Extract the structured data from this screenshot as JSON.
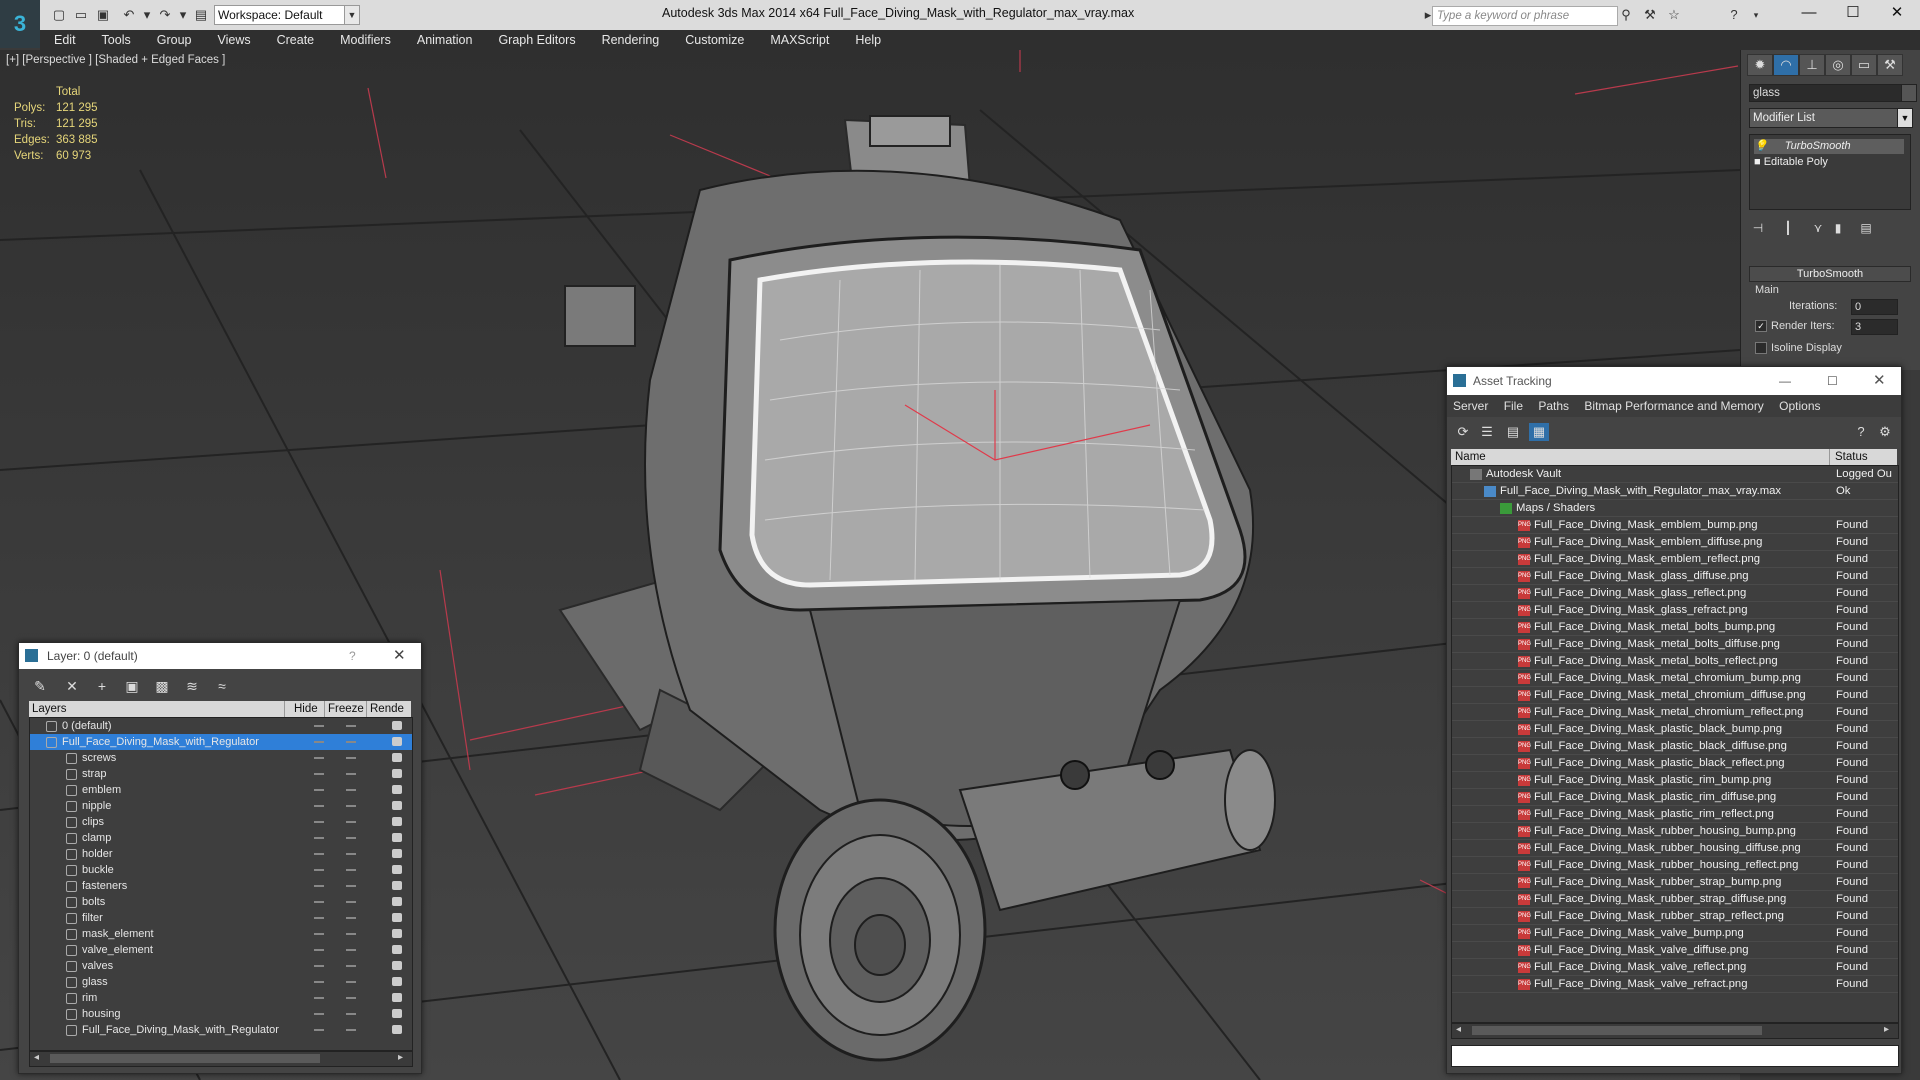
{
  "app": {
    "title": "Autodesk 3ds Max  2014 x64      Full_Face_Diving_Mask_with_Regulator_max_vray.max",
    "workspace": "Workspace: Default",
    "search_placeholder": "Type a keyword or phrase"
  },
  "menu": [
    "Edit",
    "Tools",
    "Group",
    "Views",
    "Create",
    "Modifiers",
    "Animation",
    "Graph Editors",
    "Rendering",
    "Customize",
    "MAXScript",
    "Help"
  ],
  "viewport": {
    "label": "[+] [Perspective ] [Shaded + Edged Faces ]",
    "stats_header": "Total",
    "stats": [
      {
        "label": "Polys:",
        "value": "121 295"
      },
      {
        "label": "Tris:",
        "value": "121 295"
      },
      {
        "label": "Edges:",
        "value": "363 885"
      },
      {
        "label": "Verts:",
        "value": "60 973"
      }
    ]
  },
  "command_panel": {
    "object_name": "glass",
    "modifier_list": "Modifier List",
    "stack": [
      "TurboSmooth",
      "Editable Poly"
    ],
    "rollout_title": "TurboSmooth",
    "group_main": "Main",
    "iterations_label": "Iterations:",
    "iterations_value": "0",
    "render_iters_label": "Render Iters:",
    "render_iters_value": "3",
    "isoline_label": "Isoline Display"
  },
  "layer_window": {
    "title": "Layer: 0 (default)",
    "columns": {
      "layers": "Layers",
      "hide": "Hide",
      "freeze": "Freeze",
      "render": "Rende"
    },
    "layers": [
      {
        "name": "0 (default)",
        "level": 0,
        "selected": false
      },
      {
        "name": "Full_Face_Diving_Mask_with_Regulator",
        "level": 0,
        "selected": true
      },
      {
        "name": "screws",
        "level": 1,
        "selected": false
      },
      {
        "name": "strap",
        "level": 1,
        "selected": false
      },
      {
        "name": "emblem",
        "level": 1,
        "selected": false
      },
      {
        "name": "nipple",
        "level": 1,
        "selected": false
      },
      {
        "name": "clips",
        "level": 1,
        "selected": false
      },
      {
        "name": "clamp",
        "level": 1,
        "selected": false
      },
      {
        "name": "holder",
        "level": 1,
        "selected": false
      },
      {
        "name": "buckle",
        "level": 1,
        "selected": false
      },
      {
        "name": "fasteners",
        "level": 1,
        "selected": false
      },
      {
        "name": "bolts",
        "level": 1,
        "selected": false
      },
      {
        "name": "filter",
        "level": 1,
        "selected": false
      },
      {
        "name": "mask_element",
        "level": 1,
        "selected": false
      },
      {
        "name": "valve_element",
        "level": 1,
        "selected": false
      },
      {
        "name": "valves",
        "level": 1,
        "selected": false
      },
      {
        "name": "glass",
        "level": 1,
        "selected": false
      },
      {
        "name": "rim",
        "level": 1,
        "selected": false
      },
      {
        "name": "housing",
        "level": 1,
        "selected": false
      },
      {
        "name": "Full_Face_Diving_Mask_with_Regulator",
        "level": 1,
        "selected": false
      }
    ]
  },
  "asset_window": {
    "title": "Asset Tracking",
    "menu": [
      "Server",
      "File",
      "Paths",
      "Bitmap Performance and Memory",
      "Options"
    ],
    "columns": {
      "name": "Name",
      "status": "Status"
    },
    "rows": [
      {
        "name": "Autodesk Vault",
        "status": "Logged Ou",
        "level": 0,
        "kind": "vault"
      },
      {
        "name": "Full_Face_Diving_Mask_with_Regulator_max_vray.max",
        "status": "Ok",
        "level": 1,
        "kind": "max"
      },
      {
        "name": "Maps / Shaders",
        "status": "",
        "level": 2,
        "kind": "folder"
      },
      {
        "name": "Full_Face_Diving_Mask_emblem_bump.png",
        "status": "Found",
        "level": 3,
        "kind": "png"
      },
      {
        "name": "Full_Face_Diving_Mask_emblem_diffuse.png",
        "status": "Found",
        "level": 3,
        "kind": "png"
      },
      {
        "name": "Full_Face_Diving_Mask_emblem_reflect.png",
        "status": "Found",
        "level": 3,
        "kind": "png"
      },
      {
        "name": "Full_Face_Diving_Mask_glass_diffuse.png",
        "status": "Found",
        "level": 3,
        "kind": "png"
      },
      {
        "name": "Full_Face_Diving_Mask_glass_reflect.png",
        "status": "Found",
        "level": 3,
        "kind": "png"
      },
      {
        "name": "Full_Face_Diving_Mask_glass_refract.png",
        "status": "Found",
        "level": 3,
        "kind": "png"
      },
      {
        "name": "Full_Face_Diving_Mask_metal_bolts_bump.png",
        "status": "Found",
        "level": 3,
        "kind": "png"
      },
      {
        "name": "Full_Face_Diving_Mask_metal_bolts_diffuse.png",
        "status": "Found",
        "level": 3,
        "kind": "png"
      },
      {
        "name": "Full_Face_Diving_Mask_metal_bolts_reflect.png",
        "status": "Found",
        "level": 3,
        "kind": "png"
      },
      {
        "name": "Full_Face_Diving_Mask_metal_chromium_bump.png",
        "status": "Found",
        "level": 3,
        "kind": "png"
      },
      {
        "name": "Full_Face_Diving_Mask_metal_chromium_diffuse.png",
        "status": "Found",
        "level": 3,
        "kind": "png"
      },
      {
        "name": "Full_Face_Diving_Mask_metal_chromium_reflect.png",
        "status": "Found",
        "level": 3,
        "kind": "png"
      },
      {
        "name": "Full_Face_Diving_Mask_plastic_black_bump.png",
        "status": "Found",
        "level": 3,
        "kind": "png"
      },
      {
        "name": "Full_Face_Diving_Mask_plastic_black_diffuse.png",
        "status": "Found",
        "level": 3,
        "kind": "png"
      },
      {
        "name": "Full_Face_Diving_Mask_plastic_black_reflect.png",
        "status": "Found",
        "level": 3,
        "kind": "png"
      },
      {
        "name": "Full_Face_Diving_Mask_plastic_rim_bump.png",
        "status": "Found",
        "level": 3,
        "kind": "png"
      },
      {
        "name": "Full_Face_Diving_Mask_plastic_rim_diffuse.png",
        "status": "Found",
        "level": 3,
        "kind": "png"
      },
      {
        "name": "Full_Face_Diving_Mask_plastic_rim_reflect.png",
        "status": "Found",
        "level": 3,
        "kind": "png"
      },
      {
        "name": "Full_Face_Diving_Mask_rubber_housing_bump.png",
        "status": "Found",
        "level": 3,
        "kind": "png"
      },
      {
        "name": "Full_Face_Diving_Mask_rubber_housing_diffuse.png",
        "status": "Found",
        "level": 3,
        "kind": "png"
      },
      {
        "name": "Full_Face_Diving_Mask_rubber_housing_reflect.png",
        "status": "Found",
        "level": 3,
        "kind": "png"
      },
      {
        "name": "Full_Face_Diving_Mask_rubber_strap_bump.png",
        "status": "Found",
        "level": 3,
        "kind": "png"
      },
      {
        "name": "Full_Face_Diving_Mask_rubber_strap_diffuse.png",
        "status": "Found",
        "level": 3,
        "kind": "png"
      },
      {
        "name": "Full_Face_Diving_Mask_rubber_strap_reflect.png",
        "status": "Found",
        "level": 3,
        "kind": "png"
      },
      {
        "name": "Full_Face_Diving_Mask_valve_bump.png",
        "status": "Found",
        "level": 3,
        "kind": "png"
      },
      {
        "name": "Full_Face_Diving_Mask_valve_diffuse.png",
        "status": "Found",
        "level": 3,
        "kind": "png"
      },
      {
        "name": "Full_Face_Diving_Mask_valve_reflect.png",
        "status": "Found",
        "level": 3,
        "kind": "png"
      },
      {
        "name": "Full_Face_Diving_Mask_valve_refract.png",
        "status": "Found",
        "level": 3,
        "kind": "png"
      }
    ]
  },
  "colors": {
    "stats_yellow": "#e6d67a",
    "selection_blue": "#2f7fd8",
    "png_red": "#c83a3a",
    "axis_red": "#ff4a6a",
    "grid_line": "#222222"
  }
}
